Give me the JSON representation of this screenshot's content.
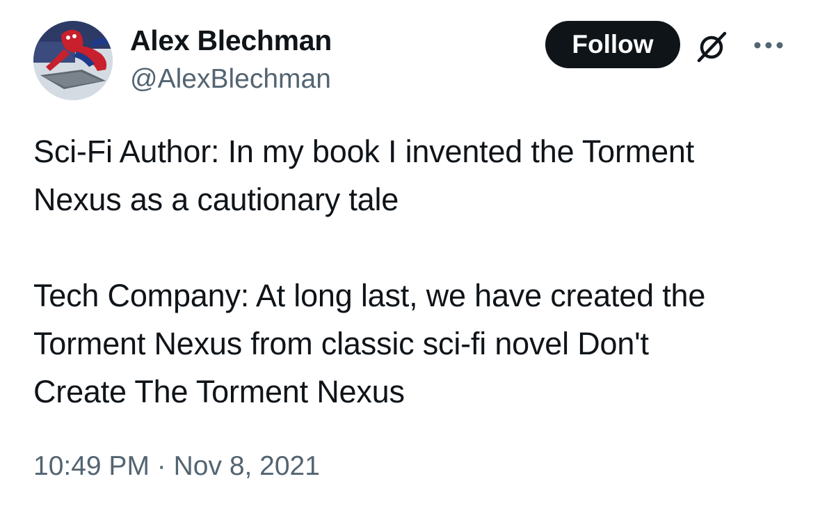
{
  "author": {
    "name": "Alex Blechman",
    "handle": "@AlexBlechman"
  },
  "actions": {
    "follow_label": "Follow",
    "grok_icon": "grok-slash-circle-icon",
    "more_icon": "more-horizontal-icon"
  },
  "tweet": {
    "para1_line1": "Sci-Fi Author: In my book I invented the Torment",
    "para1_line2": "Nexus as a cautionary tale",
    "para2_line1": "Tech Company: At long last, we have created the",
    "para2_line2": "Torment Nexus from classic sci-fi novel Don't",
    "para2_line3": "Create The Torment Nexus"
  },
  "meta": {
    "time": "10:49 PM",
    "separator": "·",
    "date": "Nov 8, 2021"
  },
  "colors": {
    "text": "#0f1419",
    "secondary": "#536471",
    "follow_bg": "#0f1419",
    "follow_text": "#ffffff"
  }
}
